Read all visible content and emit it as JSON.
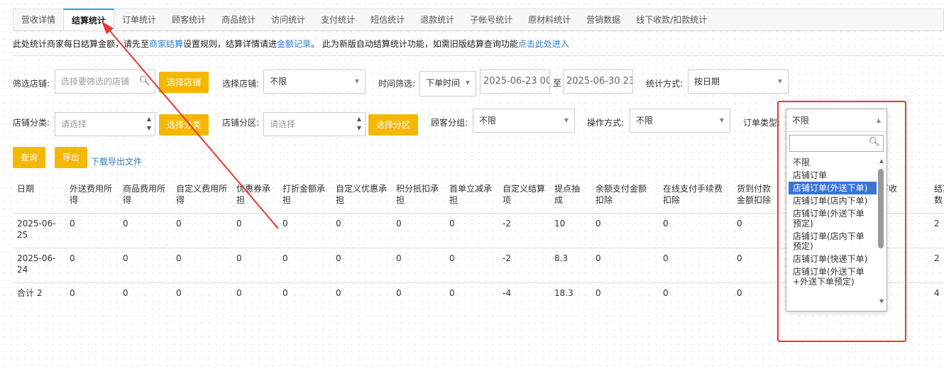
{
  "tabs": [
    "营收详情",
    "结算统计",
    "订单统计",
    "顾客统计",
    "商品统计",
    "访问统计",
    "支付统计",
    "短信统计",
    "退款统计",
    "子帐号统计",
    "原材料统计",
    "营销数据",
    "线下收款/扣款统计"
  ],
  "active_tab": 1,
  "notice": {
    "t1": "此处统计商家每日结算金额，请先至",
    "link1": "商家结算",
    "t2": "设置规则，结算详情请进",
    "link2": "金额记录",
    "t3": "。 此为新版自动结算统计功能，如需旧版结算查询功能",
    "link3": "点击此处进入"
  },
  "filters": {
    "store_filter_label": "筛选店铺:",
    "store_filter_placeholder": "选择要筛选的店铺",
    "select_store_btn": "选择店铺",
    "select_store_label": "选择店铺:",
    "select_store_value": "不限",
    "time_label": "时间筛选:",
    "time_type": "下单时间",
    "date_start": "2025-06-23 00:",
    "date_sep": "至",
    "date_end": "2025-06-30 23:",
    "stat_label": "统计方式:",
    "stat_value": "按日期",
    "category_label": "店铺分类:",
    "category_placeholder": "请选择",
    "select_category_btn": "选择分类",
    "zone_label": "店铺分区:",
    "zone_placeholder": "请选择",
    "select_zone_btn": "选择分区",
    "group_label": "顾客分组:",
    "group_value": "不限",
    "op_label": "操作方式:",
    "op_value": "不限",
    "order_type_label": "订单类型:",
    "order_type_value": "不限"
  },
  "actions": {
    "query": "查询",
    "export": "导出",
    "download": "下载导出文件"
  },
  "table": {
    "headers": [
      "日期",
      "外送费用所得",
      "商品费用所得",
      "自定义费用所得",
      "优惠券承担",
      "打折金额承担",
      "自定义优惠承担",
      "积分抵扣承担",
      "首单立减承担",
      "自定义结算项",
      "提点抽成",
      "余额支付金额扣除",
      "在线支付手续费扣除",
      "货到付款金额扣除",
      "",
      "含线下收",
      "结算数"
    ],
    "rows": [
      [
        "2025-06-25",
        "0",
        "0",
        "0",
        "0",
        "0",
        "0",
        "0",
        "0",
        "-2",
        "10",
        "0",
        "0",
        "0",
        "",
        "",
        "2"
      ],
      [
        "2025-06-24",
        "0",
        "0",
        "0",
        "0",
        "0",
        "0",
        "0",
        "0",
        "-2",
        "8.3",
        "0",
        "0",
        "0",
        "",
        "",
        "2"
      ],
      [
        "合计 2",
        "0",
        "0",
        "0",
        "0",
        "0",
        "0",
        "0",
        "0",
        "-4",
        "18.3",
        "0",
        "0",
        "0",
        "",
        "",
        "4"
      ]
    ]
  },
  "dropdown": {
    "items": [
      "不限",
      "店铺订单",
      "店铺订单(外送下单)",
      "店铺订单(店内下单)",
      "店铺订单(外送下单预定)",
      "店铺订单(店内下单预定)",
      "店铺订单(快递下单)",
      "店铺订单(外送下单+外送下单预定)"
    ],
    "highlighted": 2
  },
  "colors": {
    "accent": "#f5b800",
    "link": "#2a7ec6",
    "highlight": "#3875d7",
    "annotation": "#e53935"
  }
}
